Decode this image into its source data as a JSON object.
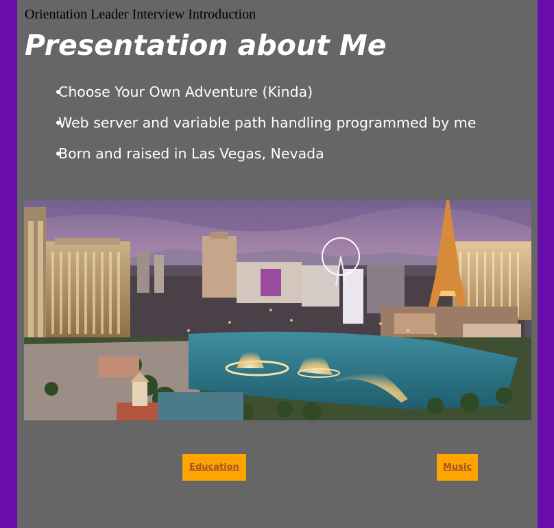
{
  "page": {
    "tab_title": "Orientation Leader Interview Introduction",
    "heading": "Presentation about Me"
  },
  "bullets": [
    {
      "text": "Choose Your Own Adventure (Kinda)"
    },
    {
      "text": "Web server and variable path handling programmed by me"
    },
    {
      "text": "Born and raised in Las Vegas, Nevada"
    }
  ],
  "image": {
    "subject": "Las Vegas Strip skyline at dusk with Bellagio fountains and Eiffel Tower replica"
  },
  "nav": {
    "education_label": "Education",
    "music_label": "Music"
  },
  "colors": {
    "frame": "#6a0dad",
    "background": "#666666",
    "button": "#ffa500",
    "button_text": "#a0522d",
    "heading": "#ffffff"
  }
}
